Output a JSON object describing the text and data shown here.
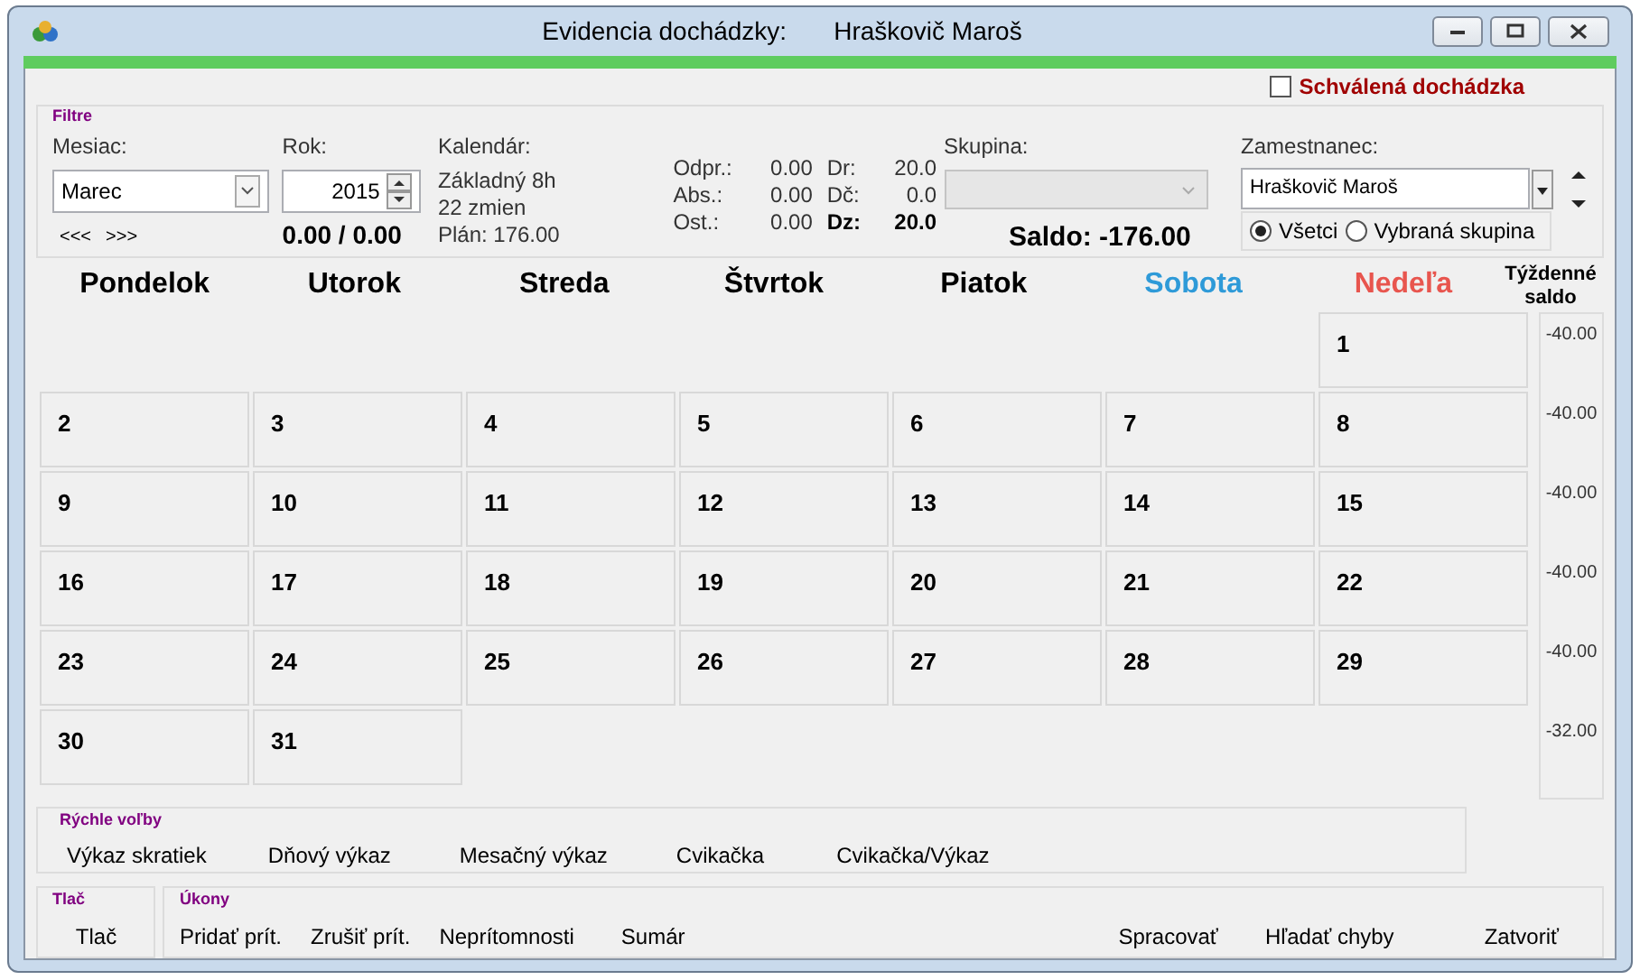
{
  "window": {
    "title": "Evidencia dochádzky:",
    "employee_name": "Hraškovič Maroš"
  },
  "approved": {
    "label": "Schválená dochádzka",
    "checked": false
  },
  "filters": {
    "heading": "Filtre",
    "month": {
      "label": "Mesiac:",
      "value": "Marec",
      "nav": [
        "<<<",
        ">>>"
      ]
    },
    "year": {
      "label": "Rok:",
      "value": "2015",
      "totals": "0.00 / 0.00"
    },
    "calendar_info": {
      "label": "Kalendár:",
      "lines": [
        "Základný 8h",
        "22 zmien",
        "Plán: 176.00"
      ]
    },
    "stats": [
      [
        {
          "label": "Odpr.:",
          "value": "0.00",
          "bold": false
        },
        {
          "label": "Abs.:",
          "value": "0.00",
          "bold": false
        },
        {
          "label": "Ost.:",
          "value": "0.00",
          "bold": false
        }
      ],
      [
        {
          "label": "Dr:",
          "value": "20.0",
          "bold": false
        },
        {
          "label": "Dč:",
          "value": "0.0",
          "bold": false
        },
        {
          "label": "Dz:",
          "value": "20.0",
          "bold": true
        }
      ]
    ],
    "group": {
      "label": "Skupina:",
      "disabled": true
    },
    "saldo": "Saldo: -176.00",
    "employee": {
      "label": "Zamestnanec:",
      "value": "Hraškovič Maroš"
    },
    "radios": [
      {
        "label": "Všetci",
        "selected": true
      },
      {
        "label": "Vybraná skupina",
        "selected": false
      }
    ]
  },
  "calendar": {
    "weekdays": [
      {
        "label": "Pondelok",
        "kind": "weekday"
      },
      {
        "label": "Utorok",
        "kind": "weekday"
      },
      {
        "label": "Streda",
        "kind": "weekday"
      },
      {
        "label": "Štvrtok",
        "kind": "weekday"
      },
      {
        "label": "Piatok",
        "kind": "weekday"
      },
      {
        "label": "Sobota",
        "kind": "saturday"
      },
      {
        "label": "Nedeľa",
        "kind": "sunday"
      }
    ],
    "saldo_heading": "Týždenné saldo",
    "weeks": [
      {
        "days": [
          {
            "kind": "blank"
          },
          {
            "kind": "blank"
          },
          {
            "kind": "blank"
          },
          {
            "kind": "blank"
          },
          {
            "kind": "blank"
          },
          {
            "kind": "blank"
          },
          {
            "kind": "day",
            "label": "1"
          }
        ],
        "saldo": "-40.00"
      },
      {
        "days": [
          {
            "kind": "day",
            "label": "2"
          },
          {
            "kind": "day",
            "label": "3"
          },
          {
            "kind": "day",
            "label": "4"
          },
          {
            "kind": "day",
            "label": "5"
          },
          {
            "kind": "day",
            "label": "6"
          },
          {
            "kind": "day",
            "label": "7"
          },
          {
            "kind": "day",
            "label": "8"
          }
        ],
        "saldo": "-40.00"
      },
      {
        "days": [
          {
            "kind": "day",
            "label": "9"
          },
          {
            "kind": "day",
            "label": "10"
          },
          {
            "kind": "day",
            "label": "11"
          },
          {
            "kind": "day",
            "label": "12"
          },
          {
            "kind": "day",
            "label": "13"
          },
          {
            "kind": "day",
            "label": "14"
          },
          {
            "kind": "day",
            "label": "15"
          }
        ],
        "saldo": "-40.00"
      },
      {
        "days": [
          {
            "kind": "day",
            "label": "16"
          },
          {
            "kind": "day",
            "label": "17"
          },
          {
            "kind": "day",
            "label": "18"
          },
          {
            "kind": "day",
            "label": "19"
          },
          {
            "kind": "day",
            "label": "20"
          },
          {
            "kind": "day",
            "label": "21"
          },
          {
            "kind": "day",
            "label": "22"
          }
        ],
        "saldo": "-40.00"
      },
      {
        "days": [
          {
            "kind": "day",
            "label": "23"
          },
          {
            "kind": "day",
            "label": "24"
          },
          {
            "kind": "day",
            "label": "25"
          },
          {
            "kind": "day",
            "label": "26"
          },
          {
            "kind": "day",
            "label": "27"
          },
          {
            "kind": "day",
            "label": "28"
          },
          {
            "kind": "day",
            "label": "29"
          }
        ],
        "saldo": "-40.00"
      },
      {
        "days": [
          {
            "kind": "day",
            "label": "30"
          },
          {
            "kind": "day",
            "label": "31"
          },
          {
            "kind": "blank"
          },
          {
            "kind": "blank"
          },
          {
            "kind": "blank"
          },
          {
            "kind": "blank"
          },
          {
            "kind": "blank"
          }
        ],
        "saldo": "-32.00"
      }
    ]
  },
  "quick": {
    "heading": "Rýchle voľby",
    "buttons": [
      "Výkaz skratiek",
      "Dňový výkaz",
      "Mesačný výkaz",
      "Cvikačka",
      "Cvikačka/Výkaz"
    ]
  },
  "print": {
    "heading": "Tlač",
    "buttons": [
      "Tlač"
    ]
  },
  "actions": {
    "heading": "Úkony",
    "groups": [
      [
        "Pridať prít.",
        "Zrušiť prít.",
        "Neprítomnosti",
        "Sumár"
      ],
      [
        "Spracovať",
        "Hľadať chyby"
      ],
      [
        "Zatvoriť"
      ]
    ]
  }
}
